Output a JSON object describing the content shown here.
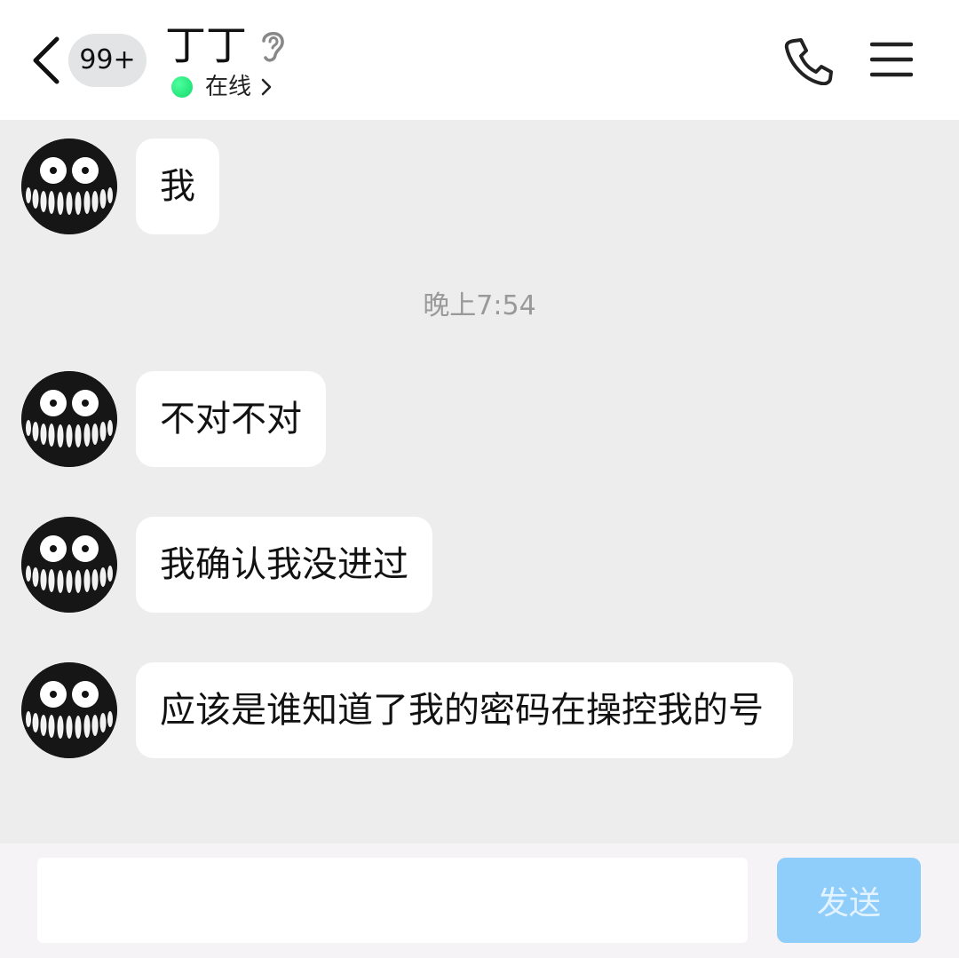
{
  "header": {
    "unread_count": "99+",
    "contact_name": "丁丁",
    "status": "在线",
    "icons": [
      "back-icon",
      "ear-icon",
      "phone-icon",
      "menu-icon",
      "chevron-right-icon"
    ]
  },
  "messages": [
    {
      "text": "我"
    },
    {
      "text": "不对不对"
    },
    {
      "text": "我确认我没进过"
    },
    {
      "text": "应该是谁知道了我的密码在操控我的号"
    }
  ],
  "time_divider": "晚上7:54",
  "composer": {
    "input_value": "",
    "send_label": "发送"
  },
  "colors": {
    "background": "#ededed",
    "bubble": "#ffffff",
    "online": "#13d96b",
    "send_button": "#8fcdfb"
  }
}
